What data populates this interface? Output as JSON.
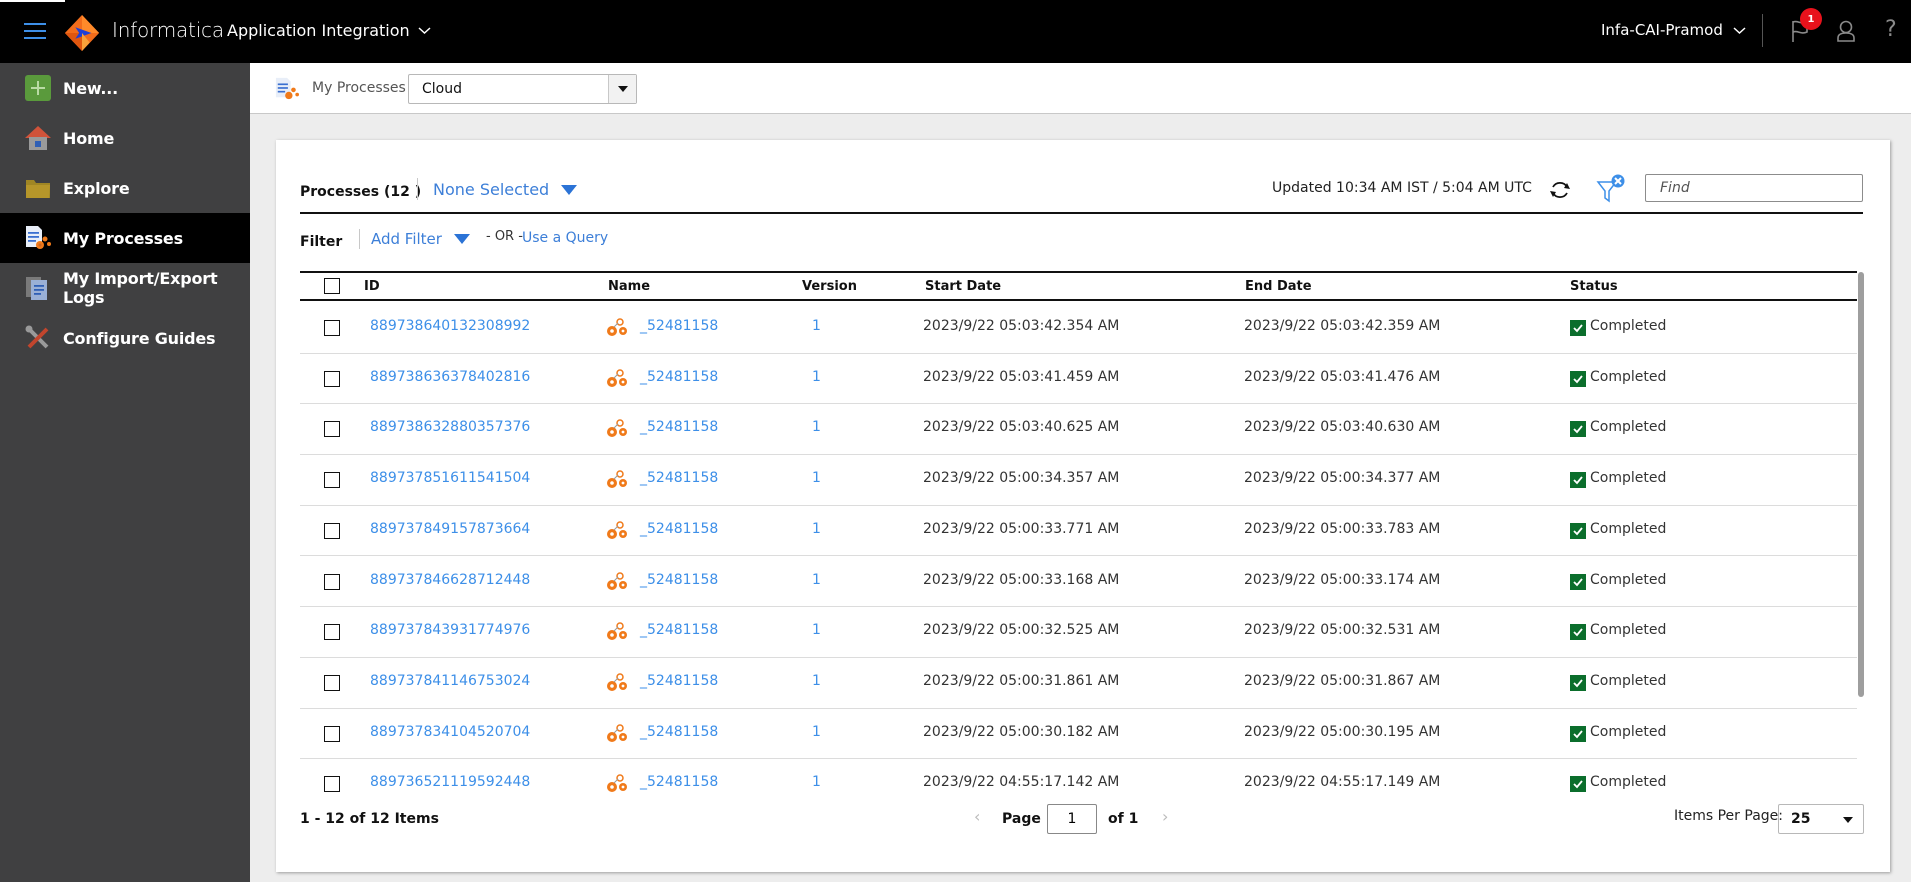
{
  "header": {
    "brand": "Informatica",
    "app_name": "Application Integration",
    "org_name": "Infa-CAI-Pramod",
    "notification_count": "1",
    "help_label": "?"
  },
  "sidebar": {
    "items": [
      {
        "label": "New...",
        "icon": "plus-icon",
        "active": false
      },
      {
        "label": "Home",
        "icon": "home-icon",
        "active": false
      },
      {
        "label": "Explore",
        "icon": "folder-icon",
        "active": false
      },
      {
        "label": "My Processes",
        "icon": "processes-icon",
        "active": true
      },
      {
        "label": "My Import/Export Logs",
        "icon": "logs-icon",
        "active": false
      },
      {
        "label": "Configure Guides",
        "icon": "tools-icon",
        "active": false
      }
    ]
  },
  "toolbar": {
    "title": "My Processes",
    "location_select": "Cloud"
  },
  "panel": {
    "title": "Processes (12 )",
    "selection": "None Selected",
    "updated": "Updated 10:34 AM IST / 5:04 AM UTC",
    "find_placeholder": "Find",
    "filter_label": "Filter",
    "add_filter": "Add Filter",
    "or_label": "- OR -",
    "use_query": "Use a Query"
  },
  "table": {
    "columns": [
      "ID",
      "Name",
      "Version",
      "Start Date",
      "End Date",
      "Status"
    ],
    "rows": [
      {
        "id": "889738640132308992",
        "name": "_52481158",
        "version": "1",
        "start": "2023/9/22 05:03:42.354 AM",
        "end": "2023/9/22 05:03:42.359 AM",
        "status": "Completed"
      },
      {
        "id": "889738636378402816",
        "name": "_52481158",
        "version": "1",
        "start": "2023/9/22 05:03:41.459 AM",
        "end": "2023/9/22 05:03:41.476 AM",
        "status": "Completed"
      },
      {
        "id": "889738632880357376",
        "name": "_52481158",
        "version": "1",
        "start": "2023/9/22 05:03:40.625 AM",
        "end": "2023/9/22 05:03:40.630 AM",
        "status": "Completed"
      },
      {
        "id": "889737851611541504",
        "name": "_52481158",
        "version": "1",
        "start": "2023/9/22 05:00:34.357 AM",
        "end": "2023/9/22 05:00:34.377 AM",
        "status": "Completed"
      },
      {
        "id": "889737849157873664",
        "name": "_52481158",
        "version": "1",
        "start": "2023/9/22 05:00:33.771 AM",
        "end": "2023/9/22 05:00:33.783 AM",
        "status": "Completed"
      },
      {
        "id": "889737846628712448",
        "name": "_52481158",
        "version": "1",
        "start": "2023/9/22 05:00:33.168 AM",
        "end": "2023/9/22 05:00:33.174 AM",
        "status": "Completed"
      },
      {
        "id": "889737843931774976",
        "name": "_52481158",
        "version": "1",
        "start": "2023/9/22 05:00:32.525 AM",
        "end": "2023/9/22 05:00:32.531 AM",
        "status": "Completed"
      },
      {
        "id": "889737841146753024",
        "name": "_52481158",
        "version": "1",
        "start": "2023/9/22 05:00:31.861 AM",
        "end": "2023/9/22 05:00:31.867 AM",
        "status": "Completed"
      },
      {
        "id": "889737834104520704",
        "name": "_52481158",
        "version": "1",
        "start": "2023/9/22 05:00:30.182 AM",
        "end": "2023/9/22 05:00:30.195 AM",
        "status": "Completed"
      },
      {
        "id": "889736521119592448",
        "name": "_52481158",
        "version": "1",
        "start": "2023/9/22 04:55:17.142 AM",
        "end": "2023/9/22 04:55:17.149 AM",
        "status": "Completed"
      }
    ]
  },
  "footer": {
    "count": "1 - 12 of 12 Items",
    "page_label": "Page",
    "page_value": "1",
    "of_label": "of 1",
    "items_per_page_label": "Items Per Page:",
    "items_per_page": "25"
  },
  "colors": {
    "link": "#3d8fe8",
    "accent": "#2b73d6",
    "status_completed": "#0b6e2c",
    "badge": "#e8121c",
    "sidebar_bg": "#404041"
  }
}
